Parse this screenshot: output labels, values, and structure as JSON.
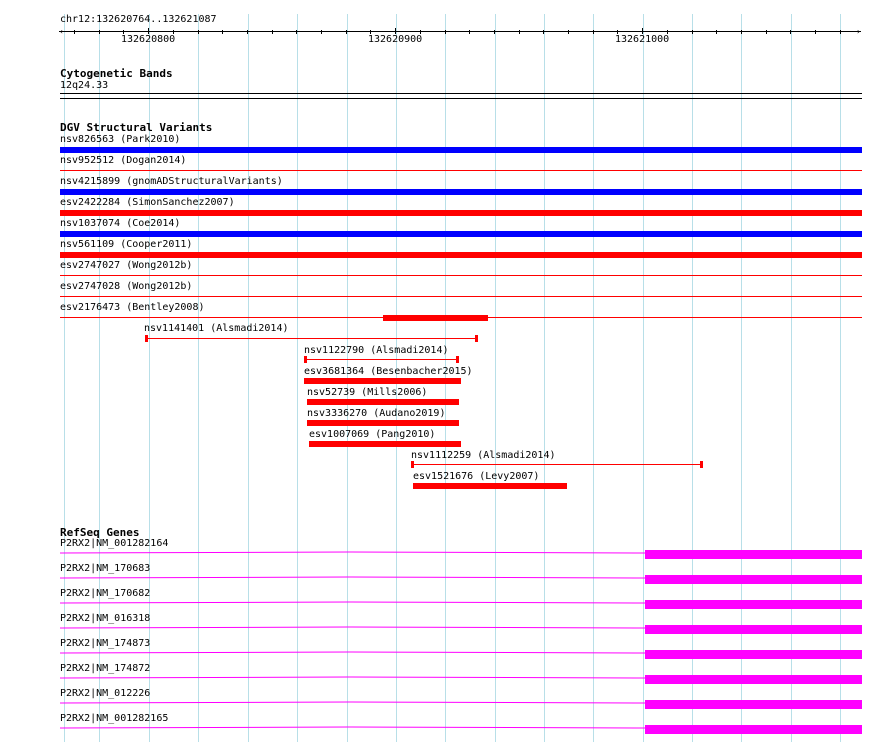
{
  "ruler": {
    "region": "chr12:132620764..132621087",
    "labels": [
      "132620800",
      "132620900",
      "132621000"
    ]
  },
  "cytoband": {
    "title": "Cytogenetic Bands",
    "band": "12q24.33"
  },
  "dgv": {
    "title": "DGV Structural Variants",
    "colors": {
      "gain": "#0000ff",
      "loss": "#ff0000"
    },
    "full_rows": [
      {
        "label": "nsv826563 (Park2010)",
        "style": "blue-thick"
      },
      {
        "label": "nsv952512 (Dogan2014)",
        "style": "red-thin"
      },
      {
        "label": "nsv4215899 (gnomADStructuralVariants)",
        "style": "blue-thick"
      },
      {
        "label": "esv2422284 (SimonSanchez2007)",
        "style": "red-thick"
      },
      {
        "label": "nsv1037074 (Coe2014)",
        "style": "blue-thick"
      },
      {
        "label": "nsv561109 (Cooper2011)",
        "style": "red-thick"
      },
      {
        "label": "esv2747027 (Wong2012b)",
        "style": "red-thin"
      },
      {
        "label": "esv2747028 (Wong2012b)",
        "style": "red-thin"
      },
      {
        "label": "esv2176473 (Bentley2008)",
        "style": "red-thin"
      }
    ],
    "partial_rows": [
      {
        "label": "nsv1141401 (Alsmadi2014)",
        "style": "thin-ends"
      },
      {
        "label": "nsv1122790 (Alsmadi2014)",
        "style": "thin-ends"
      },
      {
        "label": "esv3681364 (Besenbacher2015)",
        "style": "thick"
      },
      {
        "label": "nsv52739 (Mills2006)",
        "style": "thick"
      },
      {
        "label": "nsv3336270 (Audano2019)",
        "style": "thick"
      },
      {
        "label": "esv1007069 (Pang2010)",
        "style": "thick"
      },
      {
        "label": "nsv1112259 (Alsmadi2014)",
        "style": "thin-ends"
      },
      {
        "label": "esv1521676 (Levy2007)",
        "style": "thick"
      }
    ]
  },
  "refseq": {
    "title": "RefSeq Genes",
    "color": "#ff00ff",
    "genes": [
      "P2RX2|NM_001282164",
      "P2RX2|NM_170683",
      "P2RX2|NM_170682",
      "P2RX2|NM_016318",
      "P2RX2|NM_174873",
      "P2RX2|NM_174872",
      "P2RX2|NM_012226",
      "P2RX2|NM_001282165"
    ]
  }
}
